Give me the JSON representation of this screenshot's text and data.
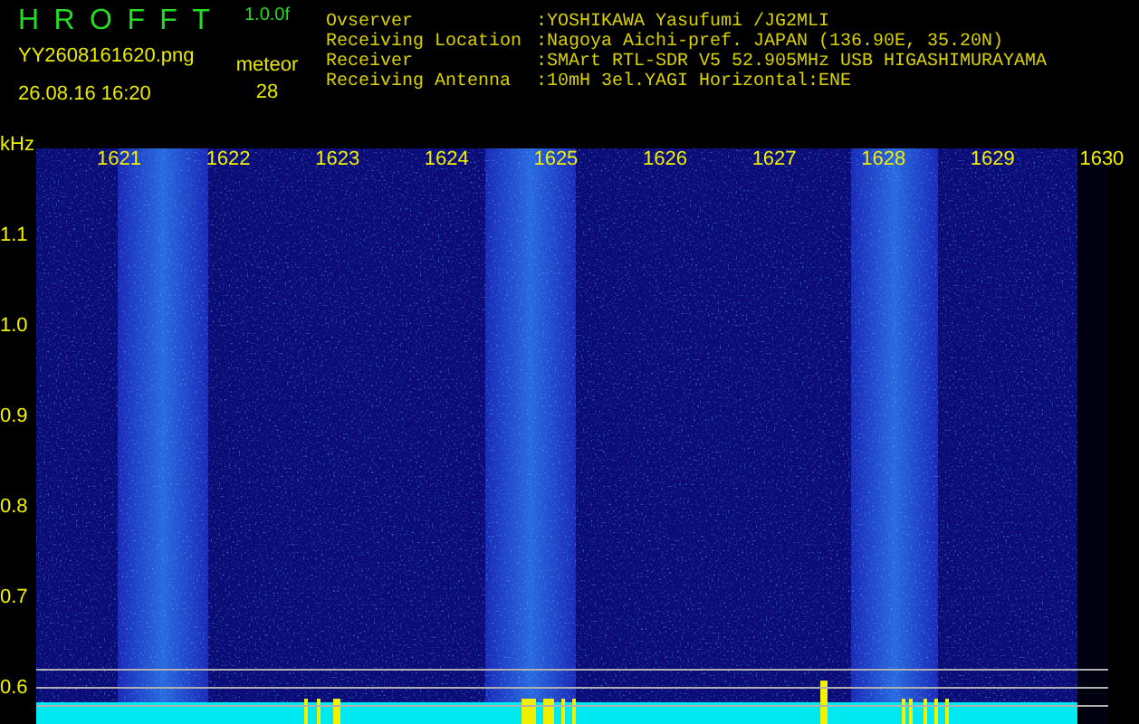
{
  "header": {
    "title_letters": [
      "H",
      "R",
      "O",
      "F",
      "F",
      "T"
    ],
    "version": "1.0.0f",
    "filename": "YY2608161620.png",
    "datetime": "26.08.16 16:20",
    "count_label": "meteor",
    "count": "28"
  },
  "info": [
    {
      "label": "Ovserver",
      "value": ":YOSHIKAWA Yasufumi /JG2MLI"
    },
    {
      "label": "Receiving Location",
      "value": ":Nagoya Aichi-pref. JAPAN (136.90E, 35.20N)"
    },
    {
      "label": "Receiver",
      "value": ":SMArt RTL-SDR V5 52.905MHz USB HIGASHIMURAYAMA"
    },
    {
      "label": "Receiving Antenna",
      "value": ":10mH 3el.YAGI Horizontal:ENE"
    }
  ],
  "spectrogram": {
    "unit": "kHz",
    "x_labels": [
      "1621",
      "1622",
      "1623",
      "1624",
      "1625",
      "1626",
      "1627",
      "1628",
      "1629",
      "1630"
    ],
    "y_labels": [
      "1.1",
      "1.0",
      "0.9",
      "0.8",
      "0.7",
      "0.6"
    ]
  }
}
